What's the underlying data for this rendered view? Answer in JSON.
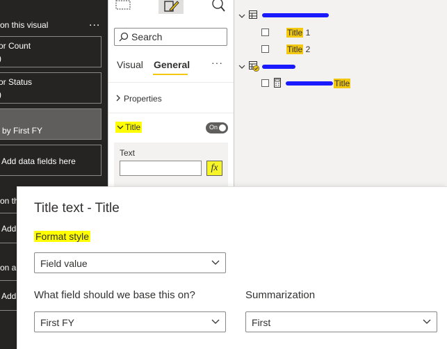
{
  "left_pane": {
    "section1_header": "on this visual",
    "section1_more": "...",
    "cards": [
      {
        "line1": "or Count",
        "line2": ")"
      },
      {
        "line1": "or Status",
        "line2": ")"
      },
      {
        "line1": "by First FY",
        "line2": ""
      },
      {
        "line1": "Add data fields here",
        "line2": ""
      }
    ],
    "section2_header": "on th",
    "section2_add": "Add",
    "section3_header": "on al",
    "section3_add": "Add"
  },
  "format_pane": {
    "search_placeholder": "Search",
    "tabs": [
      {
        "label": "Visual"
      },
      {
        "label": "General"
      }
    ],
    "more": "···",
    "properties_label": "Properties",
    "title_label": "Title",
    "toggle_label": "On",
    "text_label": "Text",
    "fx_label": "fx"
  },
  "fields_pane": {
    "items": [
      {
        "label": "Title",
        "suffix": " 1"
      },
      {
        "label": "Title",
        "suffix": " 2"
      },
      {
        "label": "Title",
        "suffix": ""
      }
    ]
  },
  "dialog": {
    "title": "Title text - Title",
    "format_style_label": "Format style",
    "format_style_value": "Field value",
    "base_field_label": "What field should we base this on?",
    "base_field_value": "First FY",
    "summarization_label": "Summarization",
    "summarization_value": "First"
  },
  "colors": {
    "highlight": "#ffff00",
    "field_highlight": "#f2c811",
    "redaction": "#1a1aff"
  }
}
